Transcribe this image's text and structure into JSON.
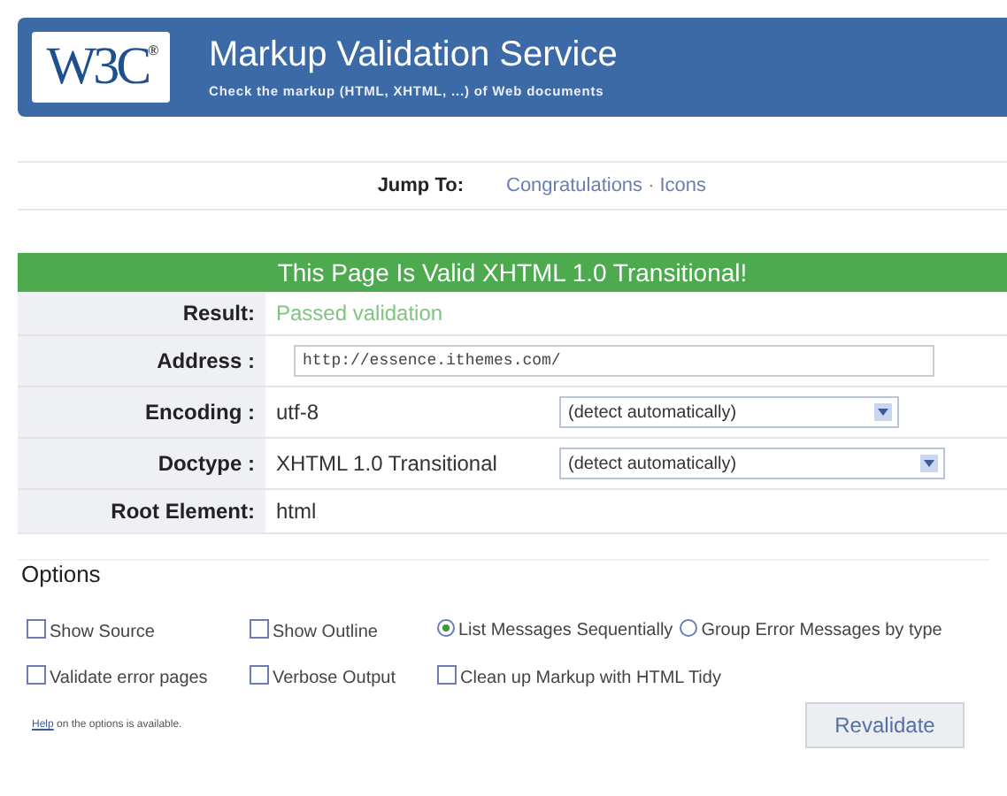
{
  "header": {
    "logo": "W3C",
    "logo_mark": "®",
    "title": "Markup Validation Service",
    "subtitle": "Check the markup (HTML, XHTML, ...) of Web documents"
  },
  "jump_to": {
    "label": "Jump To:",
    "separator": "·",
    "links": [
      "Congratulations",
      "Icons"
    ]
  },
  "banner": "This Page Is Valid XHTML 1.0 Transitional!",
  "rows": [
    {
      "kind": "result",
      "label": "Result:",
      "value": "Passed validation"
    },
    {
      "kind": "input",
      "label": "Address :",
      "value": "http://essence.ithemes.com/"
    },
    {
      "kind": "select",
      "label": "Encoding :",
      "value": "utf-8",
      "select": "(detect automatically)"
    },
    {
      "kind": "select",
      "label": "Doctype :",
      "value": "XHTML 1.0 Transitional",
      "select": "(detect automatically)"
    },
    {
      "kind": "text",
      "label": "Root Element:",
      "value": "html"
    }
  ],
  "options": {
    "title": "Options",
    "items": [
      {
        "kind": "checkbox",
        "label": "Show Source",
        "checked": false
      },
      {
        "kind": "checkbox",
        "label": "Show Outline",
        "checked": false
      },
      {
        "kind": "radio",
        "label": "List Messages Sequentially",
        "selected": true
      },
      {
        "kind": "radio",
        "label": "Group Error Messages by type",
        "selected": false
      },
      {
        "kind": "checkbox",
        "label": "Validate error pages",
        "checked": false
      },
      {
        "kind": "checkbox",
        "label": "Verbose Output",
        "checked": false
      },
      {
        "kind": "checkbox",
        "label": "Clean up Markup with HTML Tidy",
        "checked": false
      }
    ],
    "help_link": "Help",
    "help_text": "on the options is available.",
    "button": "Revalidate"
  }
}
